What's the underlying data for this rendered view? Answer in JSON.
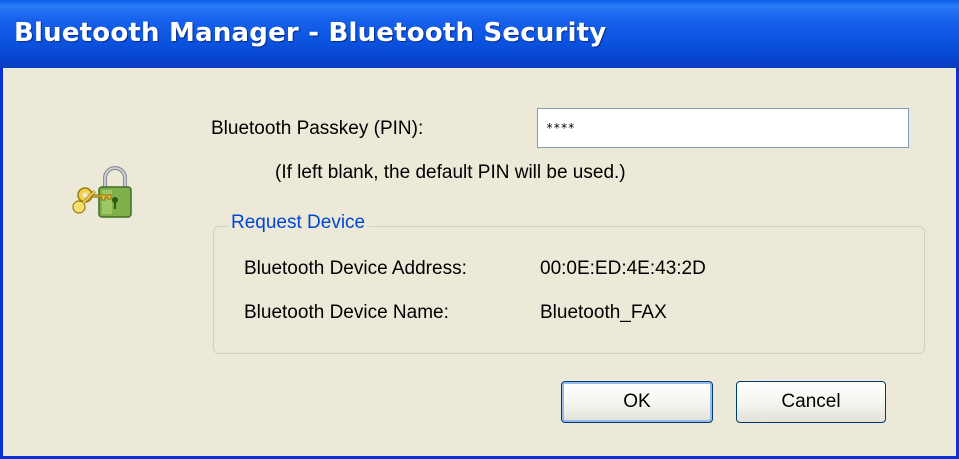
{
  "window": {
    "title": "Bluetooth Manager - Bluetooth Security"
  },
  "icon": {
    "name": "lock-with-key-icon"
  },
  "pin": {
    "label": "Bluetooth Passkey (PIN):",
    "value": "****",
    "hint": "(If left blank, the default PIN will be used.)"
  },
  "request_device": {
    "legend": "Request Device",
    "address_label": "Bluetooth Device Address:",
    "address_value": "00:0E:ED:4E:43:2D",
    "name_label": "Bluetooth Device Name:",
    "name_value": "Bluetooth_FAX"
  },
  "buttons": {
    "ok": "OK",
    "cancel": "Cancel"
  },
  "colors": {
    "titlebar": "#0b54e0",
    "dialog_bg": "#ece9d8",
    "legend_text": "#0046d5"
  }
}
